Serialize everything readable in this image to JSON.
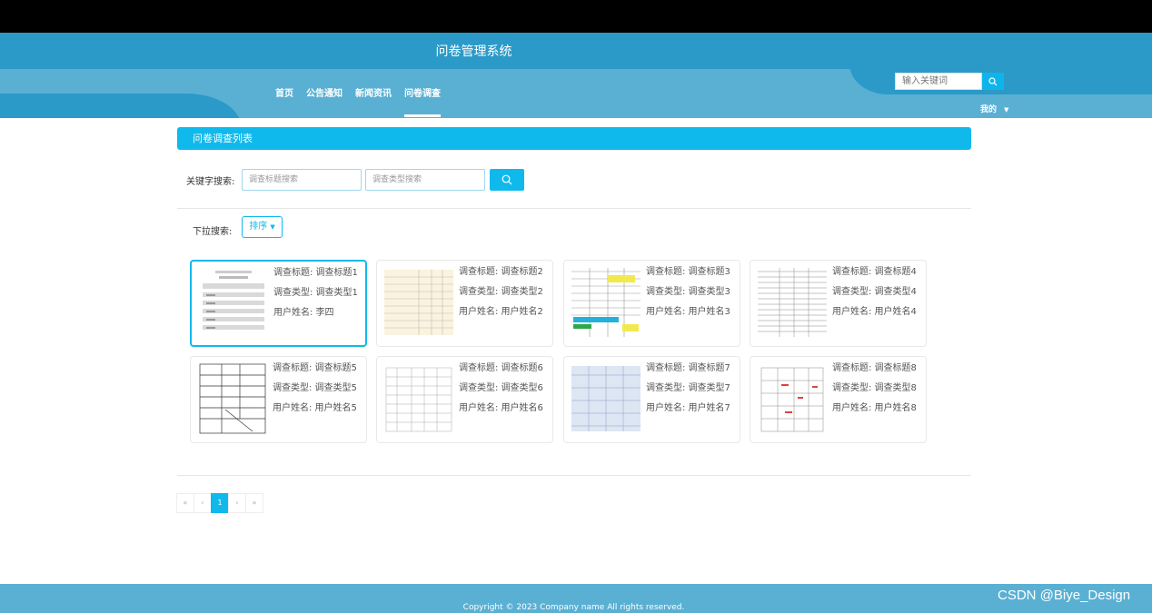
{
  "header": {
    "site_title": "问卷管理系统",
    "nav": [
      {
        "label": "首页"
      },
      {
        "label": "公告通知"
      },
      {
        "label": "新闻资讯"
      },
      {
        "label": "问卷调查",
        "active": true
      }
    ],
    "search_placeholder": "输入关键词",
    "my_menu": "我的"
  },
  "panel": {
    "title": "问卷调查列表",
    "keyword_label": "关键字搜索:",
    "title_search_placeholder": "调查标题搜索",
    "type_search_placeholder": "调查类型搜索",
    "dropdown_label": "下拉搜索:",
    "sort_label": "排序"
  },
  "cards": [
    {
      "title": "调查标题: 调查标题1",
      "type": "调查类型: 调查类型1",
      "user": "用户姓名: 李四",
      "selected": true
    },
    {
      "title": "调查标题: 调查标题2",
      "type": "调查类型: 调查类型2",
      "user": "用户姓名: 用户姓名2"
    },
    {
      "title": "调查标题: 调查标题3",
      "type": "调查类型: 调查类型3",
      "user": "用户姓名: 用户姓名3"
    },
    {
      "title": "调查标题: 调查标题4",
      "type": "调查类型: 调查类型4",
      "user": "用户姓名: 用户姓名4"
    },
    {
      "title": "调查标题: 调查标题5",
      "type": "调查类型: 调查类型5",
      "user": "用户姓名: 用户姓名5"
    },
    {
      "title": "调查标题: 调查标题6",
      "type": "调查类型: 调查类型6",
      "user": "用户姓名: 用户姓名6"
    },
    {
      "title": "调查标题: 调查标题7",
      "type": "调查类型: 调查类型7",
      "user": "用户姓名: 用户姓名7"
    },
    {
      "title": "调查标题: 调查标题8",
      "type": "调查类型: 调查类型8",
      "user": "用户姓名: 用户姓名8"
    }
  ],
  "pagination": {
    "first": "«",
    "prev": "‹",
    "current": "1",
    "next": "›",
    "last": "»"
  },
  "footer": {
    "copyright": "Copyright © 2023 Company name All rights reserved.",
    "watermark": "CSDN @Biye_Design"
  },
  "colors": {
    "accent": "#10b9ec",
    "header_dark": "#2b9ac8",
    "header_light": "#5ab0d3"
  }
}
